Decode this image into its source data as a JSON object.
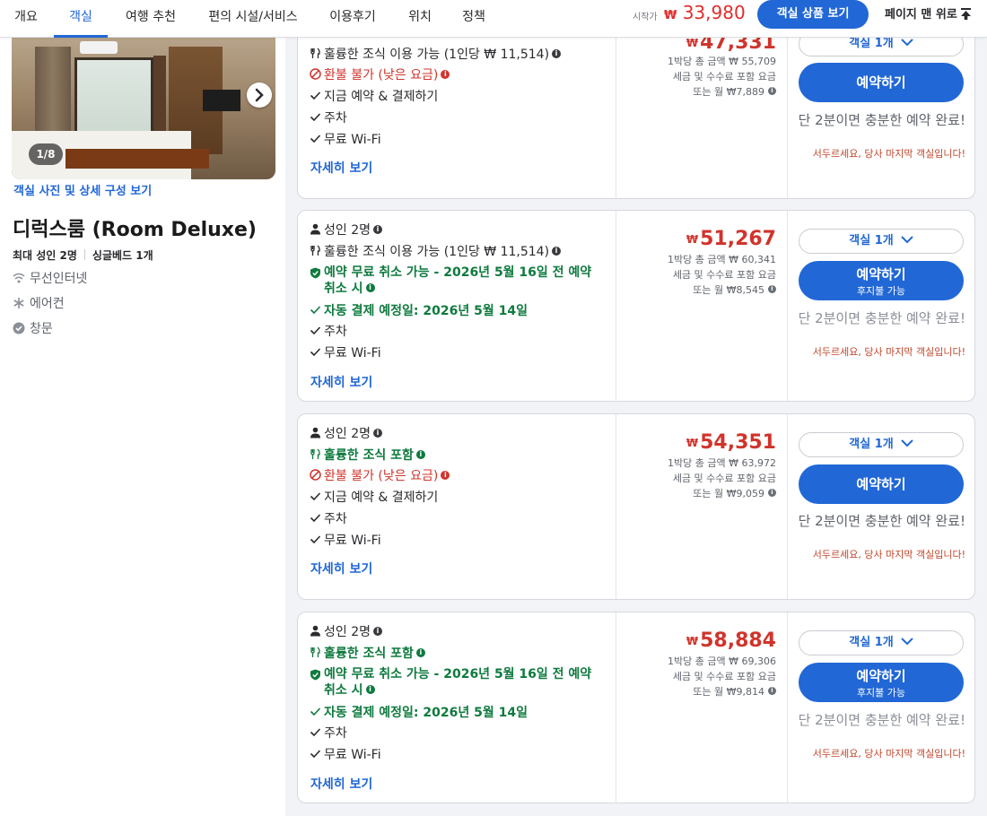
{
  "nav": {
    "tabs": [
      "개요",
      "객실",
      "여행 추천",
      "편의 시설/서비스",
      "이용후기",
      "위치",
      "정책"
    ],
    "active_tab": "객실",
    "start_label": "시작가",
    "currency": "₩",
    "start_price": "33,980",
    "view_button": "객실 상품 보기",
    "to_top": "페이지 맨 위로"
  },
  "room": {
    "photo_count": "1/8",
    "photo_link": "객실 사진 및 상세 구성 보기",
    "title": "디럭스룸 (Room Deluxe)",
    "capacity": "최대 성인 2명",
    "bed": "싱글베드 1개",
    "amenities": [
      {
        "icon": "wifi-icon",
        "label": "무선인터넷"
      },
      {
        "icon": "snowflake-icon",
        "label": "에어컨"
      },
      {
        "icon": "check-circle-icon",
        "label": "창문"
      }
    ]
  },
  "offers": [
    {
      "features": [
        {
          "type": "breakfast",
          "style": "normal",
          "text": "훌륭한 조식 이용 가능 (1인당 ₩ 11,514)"
        },
        {
          "type": "refund",
          "style": "red",
          "text": "환불 불가 (낮은 요금)"
        },
        {
          "type": "check",
          "style": "normal",
          "text": "지금 예약 & 결제하기"
        },
        {
          "type": "check",
          "style": "normal",
          "text": "주차"
        },
        {
          "type": "check",
          "style": "normal",
          "text": "무료 Wi-Fi"
        }
      ],
      "details": "자세히 보기",
      "currency": "₩",
      "price": "47,331",
      "total": "1박당 총 금액 ₩ 55,709",
      "tax": "세금 및 수수료 포함 요금",
      "monthly": "또는 월 ₩7,889",
      "room_select": "객실 1개",
      "book": "예약하기",
      "book_sub": "",
      "note": "단 2분이면 충분한 예약 완료!",
      "warn": "서두르세요, 당사 마지막 객실입니다!"
    },
    {
      "guests": "성인 2명",
      "features": [
        {
          "type": "breakfast",
          "style": "normal",
          "text": "훌륭한 조식 이용 가능 (1인당 ₩ 11,514)"
        },
        {
          "type": "shield",
          "style": "green",
          "text": "예약 무료 취소 가능 - 2026년 5월 16일 전 예약 취소 시"
        },
        {
          "type": "check",
          "style": "green",
          "text": "자동 결제 예정일: 2026년 5월 14일"
        },
        {
          "type": "check",
          "style": "normal",
          "text": "주차"
        },
        {
          "type": "check",
          "style": "normal",
          "text": "무료 Wi-Fi"
        }
      ],
      "details": "자세히 보기",
      "currency": "₩",
      "price": "51,267",
      "total": "1박당 총 금액 ₩ 60,341",
      "tax": "세금 및 수수료 포함 요금",
      "monthly": "또는 월 ₩8,545",
      "room_select": "객실 1개",
      "book": "예약하기",
      "book_sub": "후지불 가능",
      "note": "단 2분이면 충분한 예약 완료!",
      "warn": "서두르세요, 당사 마지막 객실입니다!"
    },
    {
      "guests": "성인 2명",
      "features": [
        {
          "type": "breakfast",
          "style": "green",
          "text": "훌륭한 조식 포함"
        },
        {
          "type": "refund",
          "style": "red",
          "text": "환불 불가 (낮은 요금)"
        },
        {
          "type": "check",
          "style": "normal",
          "text": "지금 예약 & 결제하기"
        },
        {
          "type": "check",
          "style": "normal",
          "text": "주차"
        },
        {
          "type": "check",
          "style": "normal",
          "text": "무료 Wi-Fi"
        }
      ],
      "details": "자세히 보기",
      "currency": "₩",
      "price": "54,351",
      "total": "1박당 총 금액 ₩ 63,972",
      "tax": "세금 및 수수료 포함 요금",
      "monthly": "또는 월 ₩9,059",
      "room_select": "객실 1개",
      "book": "예약하기",
      "book_sub": "",
      "note": "단 2분이면 충분한 예약 완료!",
      "warn": "서두르세요, 당사 마지막 객실입니다!"
    },
    {
      "guests": "성인 2명",
      "features": [
        {
          "type": "breakfast",
          "style": "green",
          "text": "훌륭한 조식 포함"
        },
        {
          "type": "shield",
          "style": "green",
          "text": "예약 무료 취소 가능 - 2026년 5월 16일 전 예약 취소 시"
        },
        {
          "type": "check",
          "style": "green",
          "text": "자동 결제 예정일: 2026년 5월 14일"
        },
        {
          "type": "check",
          "style": "normal",
          "text": "주차"
        },
        {
          "type": "check",
          "style": "normal",
          "text": "무료 Wi-Fi"
        }
      ],
      "details": "자세히 보기",
      "currency": "₩",
      "price": "58,884",
      "total": "1박당 총 금액 ₩ 69,306",
      "tax": "세금 및 수수료 포함 요금",
      "monthly": "또는 월 ₩9,814",
      "room_select": "객실 1개",
      "book": "예약하기",
      "book_sub": "후지불 가능",
      "note": "단 2분이면 충분한 예약 완료!",
      "warn": "서두르세요, 당사 마지막 객실입니다!"
    }
  ],
  "colors": {
    "accent": "#2167d6",
    "price": "#d0342c",
    "green": "#0e7a3e",
    "warn": "#c0462a"
  }
}
